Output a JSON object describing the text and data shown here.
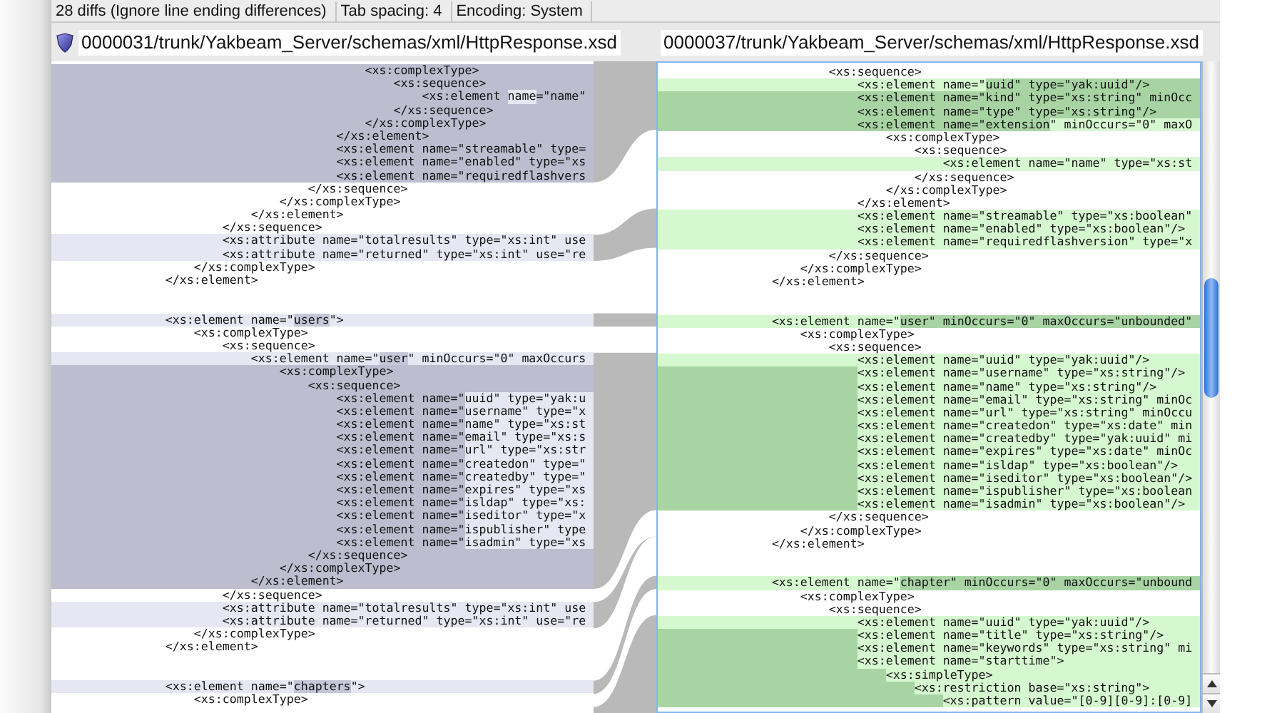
{
  "status_bar": {
    "items": [
      "28 diffs (Ignore line ending differences)",
      "Tab spacing: 4",
      "Encoding: System"
    ]
  },
  "left_pane": {
    "path": "0000031/trunk/Yakbeam_Server/schemas/xml/HttpResponse.xsd",
    "lines": [
      {
        "kind": "changed",
        "parts": [
          {
            "text": "                                            <xs:complexType>",
            "changed": false
          }
        ]
      },
      {
        "kind": "changed",
        "parts": [
          {
            "text": "                                                <xs:sequence>",
            "changed": false
          }
        ]
      },
      {
        "kind": "changed",
        "parts": [
          {
            "text": "                                                    <xs:element ",
            "changed": false
          },
          {
            "text": "name",
            "changed": true
          },
          {
            "text": "=\"name\"",
            "changed": false
          }
        ]
      },
      {
        "kind": "changed",
        "parts": [
          {
            "text": "                                                </xs:sequence>",
            "changed": false
          }
        ]
      },
      {
        "kind": "changed",
        "parts": [
          {
            "text": "                                            </xs:complexType>",
            "changed": false
          }
        ]
      },
      {
        "kind": "changed",
        "parts": [
          {
            "text": "                                        </xs:element>",
            "changed": false
          }
        ]
      },
      {
        "kind": "changed",
        "parts": [
          {
            "text": "                                        <xs:element name=\"streamable\" type=",
            "changed": false
          }
        ]
      },
      {
        "kind": "changed",
        "parts": [
          {
            "text": "                                        <xs:element name=\"enabled\" type=\"xs",
            "changed": false
          }
        ]
      },
      {
        "kind": "changed",
        "parts": [
          {
            "text": "                                        <xs:element name=\"requiredflashvers",
            "changed": false
          }
        ]
      },
      {
        "kind": "same",
        "parts": [
          {
            "text": "                                    </xs:sequence>",
            "changed": false
          }
        ]
      },
      {
        "kind": "same",
        "parts": [
          {
            "text": "                                </xs:complexType>",
            "changed": false
          }
        ]
      },
      {
        "kind": "same",
        "parts": [
          {
            "text": "                            </xs:element>",
            "changed": false
          }
        ]
      },
      {
        "kind": "same",
        "parts": [
          {
            "text": "                        </xs:sequence>",
            "changed": false
          }
        ]
      },
      {
        "kind": "modified",
        "parts": [
          {
            "text": "                        <xs:attribute name=\"totalresults\" type=\"xs:int\" use",
            "changed": false
          }
        ]
      },
      {
        "kind": "modified",
        "parts": [
          {
            "text": "                        <xs:attribute name=\"returned\" type=\"xs:int\" use=\"re",
            "changed": false
          }
        ]
      },
      {
        "kind": "same",
        "parts": [
          {
            "text": "                    </xs:complexType>",
            "changed": false
          }
        ]
      },
      {
        "kind": "same",
        "parts": [
          {
            "text": "                </xs:element>",
            "changed": false
          }
        ]
      },
      {
        "kind": "same"
      },
      {
        "kind": "same"
      },
      {
        "kind": "modified",
        "parts": [
          {
            "text": "                <xs:element name=\"",
            "changed": false
          },
          {
            "text": "users",
            "changed": true
          },
          {
            "text": "\">",
            "changed": false
          }
        ]
      },
      {
        "kind": "same",
        "parts": [
          {
            "text": "                    <xs:complexType>",
            "changed": false
          }
        ]
      },
      {
        "kind": "same",
        "parts": [
          {
            "text": "                        <xs:sequence>",
            "changed": false
          }
        ]
      },
      {
        "kind": "modified",
        "parts": [
          {
            "text": "                            <xs:element name=\"",
            "changed": false
          },
          {
            "text": "user",
            "changed": true
          },
          {
            "text": "\" minOccurs=\"0\" maxOccurs",
            "changed": false
          }
        ]
      },
      {
        "kind": "changed",
        "parts": [
          {
            "text": "                                <xs:complexType>",
            "changed": false
          }
        ]
      },
      {
        "kind": "changed",
        "parts": [
          {
            "text": "                                    <xs:sequence>",
            "changed": false
          }
        ]
      },
      {
        "kind": "changed",
        "parts": [
          {
            "text": "                                        <xs:element name=\"",
            "changed": false
          },
          {
            "text": "uuid\" type=\"yak:u",
            "changed": true
          }
        ]
      },
      {
        "kind": "changed",
        "parts": [
          {
            "text": "                                        <xs:element name=\"",
            "changed": false
          },
          {
            "text": "username\" type=\"x",
            "changed": true
          }
        ]
      },
      {
        "kind": "changed",
        "parts": [
          {
            "text": "                                        <xs:element name=\"",
            "changed": false
          },
          {
            "text": "name\" type=\"xs:st",
            "changed": true
          }
        ]
      },
      {
        "kind": "changed",
        "parts": [
          {
            "text": "                                        <xs:element name=\"",
            "changed": false
          },
          {
            "text": "email\" type=\"xs:s",
            "changed": true
          }
        ]
      },
      {
        "kind": "changed",
        "parts": [
          {
            "text": "                                        <xs:element name=\"",
            "changed": false
          },
          {
            "text": "url\" type=\"xs:str",
            "changed": true
          }
        ]
      },
      {
        "kind": "changed",
        "parts": [
          {
            "text": "                                        <xs:element name=\"",
            "changed": false
          },
          {
            "text": "createdon\" type=\"",
            "changed": true
          }
        ]
      },
      {
        "kind": "changed",
        "parts": [
          {
            "text": "                                        <xs:element name=\"",
            "changed": false
          },
          {
            "text": "createdby\" type=\"",
            "changed": true
          }
        ]
      },
      {
        "kind": "changed",
        "parts": [
          {
            "text": "                                        <xs:element name=\"",
            "changed": false
          },
          {
            "text": "expires\" type=\"xs",
            "changed": true
          }
        ]
      },
      {
        "kind": "changed",
        "parts": [
          {
            "text": "                                        <xs:element name=\"",
            "changed": false
          },
          {
            "text": "isldap\" type=\"xs:",
            "changed": true
          }
        ]
      },
      {
        "kind": "changed",
        "parts": [
          {
            "text": "                                        <xs:element name=\"",
            "changed": false
          },
          {
            "text": "iseditor\" type=\"x",
            "changed": true
          }
        ]
      },
      {
        "kind": "changed",
        "parts": [
          {
            "text": "                                        <xs:element name=\"",
            "changed": false
          },
          {
            "text": "ispublisher\" type",
            "changed": true
          }
        ]
      },
      {
        "kind": "changed",
        "parts": [
          {
            "text": "                                        <xs:element name=\"",
            "changed": false
          },
          {
            "text": "isadmin\" type=\"xs",
            "changed": true
          }
        ]
      },
      {
        "kind": "changed",
        "parts": [
          {
            "text": "                                    </xs:sequence>",
            "changed": false
          }
        ]
      },
      {
        "kind": "changed",
        "parts": [
          {
            "text": "                                </xs:complexType>",
            "changed": false
          }
        ]
      },
      {
        "kind": "changed",
        "parts": [
          {
            "text": "                            </xs:element>",
            "changed": false
          }
        ]
      },
      {
        "kind": "same",
        "parts": [
          {
            "text": "                        </xs:sequence>",
            "changed": false
          }
        ]
      },
      {
        "kind": "modified",
        "parts": [
          {
            "text": "                        <xs:attribute name=\"totalresults\" type=\"xs:int\" use",
            "changed": false
          }
        ]
      },
      {
        "kind": "modified",
        "parts": [
          {
            "text": "                        <xs:attribute name=\"returned\" type=\"xs:int\" use=\"re",
            "changed": false
          }
        ]
      },
      {
        "kind": "same",
        "parts": [
          {
            "text": "                    </xs:complexType>",
            "changed": false
          }
        ]
      },
      {
        "kind": "same",
        "parts": [
          {
            "text": "                </xs:element>",
            "changed": false
          }
        ]
      },
      {
        "kind": "same"
      },
      {
        "kind": "same"
      },
      {
        "kind": "modified",
        "parts": [
          {
            "text": "                <xs:element name=\"",
            "changed": false
          },
          {
            "text": "chapters",
            "changed": true
          },
          {
            "text": "\">",
            "changed": false
          }
        ]
      },
      {
        "kind": "same",
        "parts": [
          {
            "text": "                    <xs:complexType>",
            "changed": false
          }
        ]
      }
    ]
  },
  "right_pane": {
    "path": "0000037/trunk/Yakbeam_Server/schemas/xml/HttpResponse.xsd",
    "lines": [
      {
        "kind": "same",
        "indent_changed": false,
        "parts": [
          {
            "text": "                        <xs:sequence>",
            "changed": false
          }
        ]
      },
      {
        "kind": "modified",
        "indent_changed": false,
        "parts": [
          {
            "text": "                            <xs:element name=\"",
            "changed": false
          },
          {
            "text": "uuid\" type=\"yak:uuid\"/>",
            "changed": true
          }
        ]
      },
      {
        "kind": "modified",
        "indent_changed": true,
        "parts": [
          {
            "text": "                            <xs:element name=\"kind\" type=\"xs:string\" minOcc",
            "changed": true
          }
        ]
      },
      {
        "kind": "modified",
        "indent_changed": true,
        "parts": [
          {
            "text": "                            <xs:element name=\"type\" type=\"xs:string\"/>",
            "changed": true
          }
        ]
      },
      {
        "kind": "modified",
        "indent_changed": true,
        "parts": [
          {
            "text": "                            <xs:element name=\"extension",
            "changed": true
          },
          {
            "text": "\" minOccurs=\"0\" maxO",
            "changed": false
          }
        ]
      },
      {
        "kind": "same",
        "indent_changed": false,
        "parts": [
          {
            "text": "                                <xs:complexType>",
            "changed": false
          }
        ]
      },
      {
        "kind": "same",
        "indent_changed": false,
        "parts": [
          {
            "text": "                                    <xs:sequence>",
            "changed": false
          }
        ]
      },
      {
        "kind": "modified",
        "indent_changed": false,
        "parts": [
          {
            "text": "                                        <xs:element name=\"name\" type=\"xs:st",
            "changed": false
          }
        ]
      },
      {
        "kind": "same",
        "indent_changed": false,
        "parts": [
          {
            "text": "                                    </xs:sequence>",
            "changed": false
          }
        ]
      },
      {
        "kind": "same",
        "indent_changed": false,
        "parts": [
          {
            "text": "                                </xs:complexType>",
            "changed": false
          }
        ]
      },
      {
        "kind": "same",
        "indent_changed": false,
        "parts": [
          {
            "text": "                            </xs:element>",
            "changed": false
          }
        ]
      },
      {
        "kind": "modified",
        "indent_changed": false,
        "parts": [
          {
            "text": "                            <xs:element name=\"streamable\" type=\"xs:boolean\"",
            "changed": false
          }
        ]
      },
      {
        "kind": "modified",
        "indent_changed": false,
        "parts": [
          {
            "text": "                            <xs:element name=\"enabled\" type=\"xs:boolean\"/>",
            "changed": false
          }
        ]
      },
      {
        "kind": "modified",
        "indent_changed": false,
        "parts": [
          {
            "text": "                            <xs:element name=\"requiredflashversion\" type=\"x",
            "changed": false
          }
        ]
      },
      {
        "kind": "same",
        "indent_changed": false,
        "parts": [
          {
            "text": "                        </xs:sequence>",
            "changed": false
          }
        ]
      },
      {
        "kind": "same",
        "indent_changed": false,
        "parts": [
          {
            "text": "                    </xs:complexType>",
            "changed": false
          }
        ]
      },
      {
        "kind": "same",
        "indent_changed": false,
        "parts": [
          {
            "text": "                </xs:element>",
            "changed": false
          }
        ]
      },
      {
        "kind": "same"
      },
      {
        "kind": "same"
      },
      {
        "kind": "modified",
        "indent_changed": false,
        "parts": [
          {
            "text": "                <xs:element name=\"",
            "changed": false
          },
          {
            "text": "user\" minOccurs=\"0\" maxOccurs=\"unbounded\"",
            "changed": true
          }
        ]
      },
      {
        "kind": "same",
        "indent_changed": false,
        "parts": [
          {
            "text": "                    <xs:complexType>",
            "changed": false
          }
        ]
      },
      {
        "kind": "same",
        "indent_changed": false,
        "parts": [
          {
            "text": "                        <xs:sequence>",
            "changed": false
          }
        ]
      },
      {
        "kind": "modified",
        "indent_changed": false,
        "parts": [
          {
            "text": "                            <xs:element name=\"uuid\" type=\"yak:uuid\"/>",
            "changed": false
          }
        ]
      },
      {
        "kind": "modified",
        "indent_changed": true,
        "parts": [
          {
            "text": "                            <xs:element name=\"username\" type=\"xs:string\"/>",
            "changed": false
          }
        ]
      },
      {
        "kind": "modified",
        "indent_changed": true,
        "parts": [
          {
            "text": "                            <xs:element name=\"name\" type=\"xs:string\"/>",
            "changed": false
          }
        ]
      },
      {
        "kind": "modified",
        "indent_changed": true,
        "parts": [
          {
            "text": "                            <xs:element name=\"email\" type=\"xs:string\" minOc",
            "changed": false
          }
        ]
      },
      {
        "kind": "modified",
        "indent_changed": true,
        "parts": [
          {
            "text": "                            <xs:element name=\"url\" type=\"xs:string\" minOccu",
            "changed": false
          }
        ]
      },
      {
        "kind": "modified",
        "indent_changed": true,
        "parts": [
          {
            "text": "                            <xs:element name=\"createdon\" type=\"xs:date\" min",
            "changed": false
          }
        ]
      },
      {
        "kind": "modified",
        "indent_changed": true,
        "parts": [
          {
            "text": "                            <xs:element name=\"createdby\" type=\"yak:uuid\" mi",
            "changed": false
          }
        ]
      },
      {
        "kind": "modified",
        "indent_changed": true,
        "parts": [
          {
            "text": "                            <xs:element name=\"expires\" type=\"xs:date\" minOc",
            "changed": false
          }
        ]
      },
      {
        "kind": "modified",
        "indent_changed": true,
        "parts": [
          {
            "text": "                            <xs:element name=\"isldap\" type=\"xs:boolean\"/>",
            "changed": false
          }
        ]
      },
      {
        "kind": "modified",
        "indent_changed": true,
        "parts": [
          {
            "text": "                            <xs:element name=\"iseditor\" type=\"xs:boolean\"/>",
            "changed": false
          }
        ]
      },
      {
        "kind": "modified",
        "indent_changed": true,
        "parts": [
          {
            "text": "                            <xs:element name=\"ispublisher\" type=\"xs:boolean",
            "changed": false
          }
        ]
      },
      {
        "kind": "modified",
        "indent_changed": true,
        "parts": [
          {
            "text": "                            <xs:element name=\"isadmin\" type=\"xs:boolean\"/>",
            "changed": false
          }
        ]
      },
      {
        "kind": "same",
        "indent_changed": false,
        "parts": [
          {
            "text": "                        </xs:sequence>",
            "changed": false
          }
        ]
      },
      {
        "kind": "same",
        "indent_changed": false,
        "parts": [
          {
            "text": "                    </xs:complexType>",
            "changed": false
          }
        ]
      },
      {
        "kind": "same",
        "indent_changed": false,
        "parts": [
          {
            "text": "                </xs:element>",
            "changed": false
          }
        ]
      },
      {
        "kind": "same"
      },
      {
        "kind": "same"
      },
      {
        "kind": "modified",
        "indent_changed": false,
        "parts": [
          {
            "text": "                <xs:element name=\"",
            "changed": false
          },
          {
            "text": "chapter\" minOccurs=\"0\" maxOccurs=\"unbound",
            "changed": true
          }
        ]
      },
      {
        "kind": "same",
        "indent_changed": false,
        "parts": [
          {
            "text": "                    <xs:complexType>",
            "changed": false
          }
        ]
      },
      {
        "kind": "same",
        "indent_changed": false,
        "parts": [
          {
            "text": "                        <xs:sequence>",
            "changed": false
          }
        ]
      },
      {
        "kind": "modified",
        "indent_changed": false,
        "parts": [
          {
            "text": "                            <xs:element name=\"uuid\" type=\"yak:uuid\"/>",
            "changed": false
          }
        ]
      },
      {
        "kind": "modified",
        "indent_changed": true,
        "parts": [
          {
            "text": "                            <xs:element name=\"title\" type=\"xs:string\"/>",
            "changed": false
          }
        ]
      },
      {
        "kind": "modified",
        "indent_changed": true,
        "parts": [
          {
            "text": "                            <xs:element name=\"keywords\" type=\"xs:string\" mi",
            "changed": false
          }
        ]
      },
      {
        "kind": "modified",
        "indent_changed": true,
        "parts": [
          {
            "text": "                            <xs:element name=\"starttime\">",
            "changed": false
          }
        ]
      },
      {
        "kind": "modified",
        "indent_changed": true,
        "parts": [
          {
            "text": "                                <xs:simpleType>",
            "changed": false
          }
        ]
      },
      {
        "kind": "modified",
        "indent_changed": true,
        "parts": [
          {
            "text": "                                    <xs:restriction base=\"xs:string\">",
            "changed": false
          }
        ]
      },
      {
        "kind": "modified",
        "indent_changed": true,
        "parts": [
          {
            "text": "                                        <xs:pattern value=\"[0-9][0-9]:[0-9]",
            "changed": false
          }
        ]
      }
    ]
  }
}
